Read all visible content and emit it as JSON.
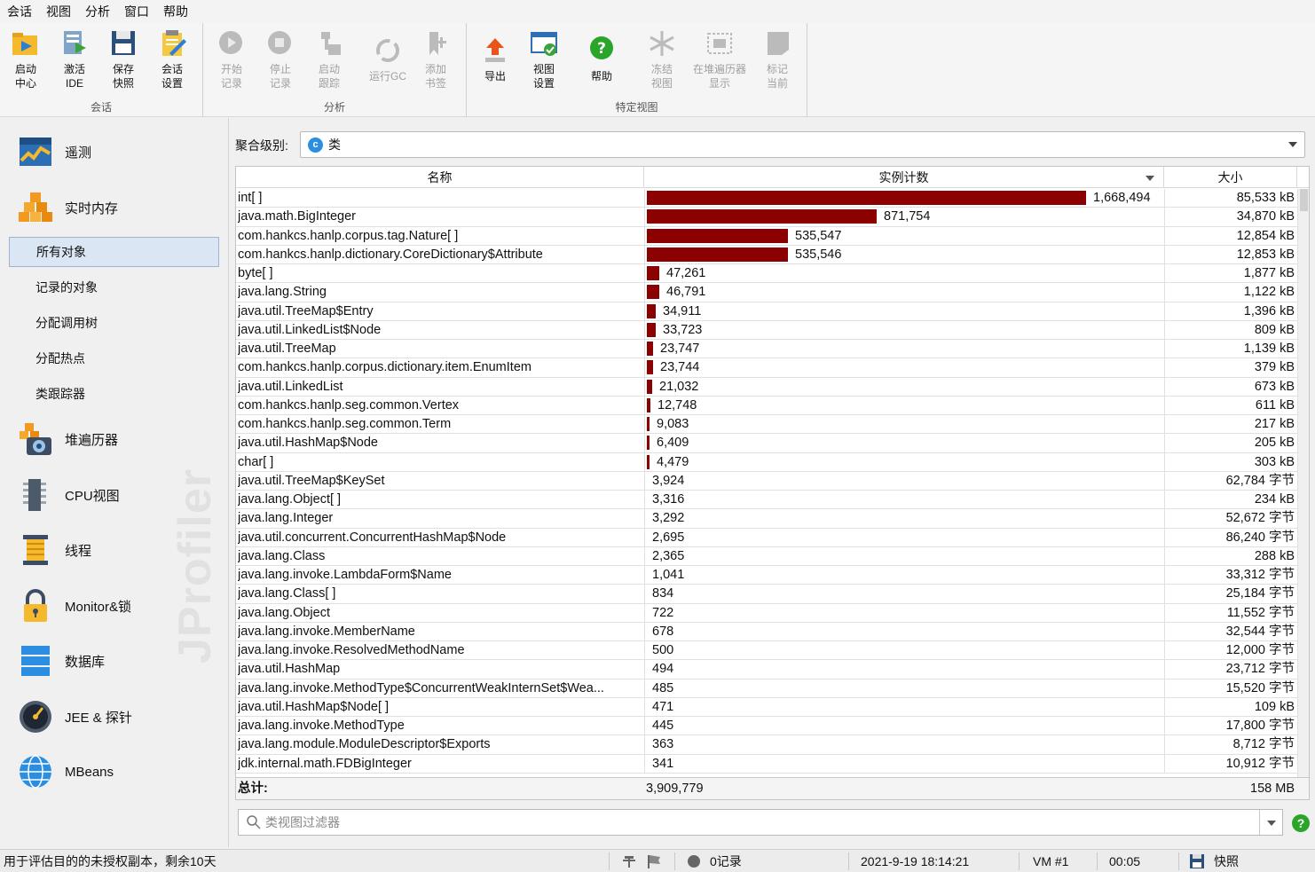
{
  "menu": [
    "会话",
    "视图",
    "分析",
    "窗口",
    "帮助"
  ],
  "toolbar": {
    "groups": [
      "会话",
      "分析",
      "特定视图"
    ],
    "buttons": [
      {
        "line1": "启动",
        "line2": "中心",
        "icon": "launch-center-icon"
      },
      {
        "line1": "激活",
        "line2": "IDE",
        "icon": "activate-ide-icon"
      },
      {
        "line1": "保存",
        "line2": "快照",
        "icon": "save-snapshot-icon"
      },
      {
        "line1": "会话",
        "line2": "设置",
        "icon": "session-settings-icon"
      },
      {
        "line1": "开始",
        "line2": "记录",
        "icon": "start-recording-icon"
      },
      {
        "line1": "停止",
        "line2": "记录",
        "icon": "stop-recording-icon"
      },
      {
        "line1": "启动",
        "line2": "跟踪",
        "icon": "start-tracking-icon"
      },
      {
        "line1": "运行GC",
        "line2": "",
        "icon": "run-gc-icon"
      },
      {
        "line1": "添加",
        "line2": "书签",
        "icon": "add-bookmark-icon"
      },
      {
        "line1": "导出",
        "line2": "",
        "icon": "export-icon"
      },
      {
        "line1": "视图",
        "line2": "设置",
        "icon": "view-settings-icon"
      },
      {
        "line1": "帮助",
        "line2": "",
        "icon": "help-icon"
      },
      {
        "line1": "冻结",
        "line2": "视图",
        "icon": "freeze-view-icon"
      },
      {
        "line1": "在堆遍历器",
        "line2": "显示",
        "icon": "show-in-heap-walker-icon"
      },
      {
        "line1": "标记",
        "line2": "当前",
        "icon": "mark-current-icon"
      }
    ]
  },
  "nav": {
    "telemetry": "遥测",
    "live_memory": "实时内存",
    "sub": [
      "所有对象",
      "记录的对象",
      "分配调用树",
      "分配热点",
      "类跟踪器"
    ],
    "heap_walker": "堆遍历器",
    "cpu": "CPU视图",
    "threads": "线程",
    "monitors": "Monitor&锁",
    "database": "数据库",
    "jee": "JEE & 探针",
    "mbeans": "MBeans",
    "watermark": "JProfiler"
  },
  "aggregation": {
    "label": "聚合级别:",
    "value": "类",
    "icon_letter": "c"
  },
  "table": {
    "headers": {
      "name": "名称",
      "count": "实例计数",
      "size": "大小"
    },
    "max_count": 1668494,
    "rows": [
      {
        "name": "int[ ]",
        "count": "1,668,494",
        "n": 1668494,
        "size": "85,533 kB"
      },
      {
        "name": "java.math.BigInteger",
        "count": "871,754",
        "n": 871754,
        "size": "34,870 kB"
      },
      {
        "name": "com.hankcs.hanlp.corpus.tag.Nature[ ]",
        "count": "535,547",
        "n": 535547,
        "size": "12,854 kB"
      },
      {
        "name": "com.hankcs.hanlp.dictionary.CoreDictionary$Attribute",
        "count": "535,546",
        "n": 535546,
        "size": "12,853 kB"
      },
      {
        "name": "byte[ ]",
        "count": "47,261",
        "n": 47261,
        "size": "1,877 kB"
      },
      {
        "name": "java.lang.String",
        "count": "46,791",
        "n": 46791,
        "size": "1,122 kB"
      },
      {
        "name": "java.util.TreeMap$Entry",
        "count": "34,911",
        "n": 34911,
        "size": "1,396 kB"
      },
      {
        "name": "java.util.LinkedList$Node",
        "count": "33,723",
        "n": 33723,
        "size": "809 kB"
      },
      {
        "name": "java.util.TreeMap",
        "count": "23,747",
        "n": 23747,
        "size": "1,139 kB"
      },
      {
        "name": "com.hankcs.hanlp.corpus.dictionary.item.EnumItem",
        "count": "23,744",
        "n": 23744,
        "size": "379 kB"
      },
      {
        "name": "java.util.LinkedList",
        "count": "21,032",
        "n": 21032,
        "size": "673 kB"
      },
      {
        "name": "com.hankcs.hanlp.seg.common.Vertex",
        "count": "12,748",
        "n": 12748,
        "size": "611 kB"
      },
      {
        "name": "com.hankcs.hanlp.seg.common.Term",
        "count": "9,083",
        "n": 9083,
        "size": "217 kB"
      },
      {
        "name": "java.util.HashMap$Node",
        "count": "6,409",
        "n": 6409,
        "size": "205 kB"
      },
      {
        "name": "char[ ]",
        "count": "4,479",
        "n": 4479,
        "size": "303 kB"
      },
      {
        "name": "java.util.TreeMap$KeySet",
        "count": "3,924",
        "n": 3924,
        "size": "62,784 字节"
      },
      {
        "name": "java.lang.Object[ ]",
        "count": "3,316",
        "n": 3316,
        "size": "234 kB"
      },
      {
        "name": "java.lang.Integer",
        "count": "3,292",
        "n": 3292,
        "size": "52,672 字节"
      },
      {
        "name": "java.util.concurrent.ConcurrentHashMap$Node",
        "count": "2,695",
        "n": 2695,
        "size": "86,240 字节"
      },
      {
        "name": "java.lang.Class",
        "count": "2,365",
        "n": 2365,
        "size": "288 kB"
      },
      {
        "name": "java.lang.invoke.LambdaForm$Name",
        "count": "1,041",
        "n": 1041,
        "size": "33,312 字节"
      },
      {
        "name": "java.lang.Class[ ]",
        "count": "834",
        "n": 834,
        "size": "25,184 字节"
      },
      {
        "name": "java.lang.Object",
        "count": "722",
        "n": 722,
        "size": "11,552 字节"
      },
      {
        "name": "java.lang.invoke.MemberName",
        "count": "678",
        "n": 678,
        "size": "32,544 字节"
      },
      {
        "name": "java.lang.invoke.ResolvedMethodName",
        "count": "500",
        "n": 500,
        "size": "12,000 字节"
      },
      {
        "name": "java.util.HashMap",
        "count": "494",
        "n": 494,
        "size": "23,712 字节"
      },
      {
        "name": "java.lang.invoke.MethodType$ConcurrentWeakInternSet$Wea...",
        "count": "485",
        "n": 485,
        "size": "15,520 字节"
      },
      {
        "name": "java.util.HashMap$Node[ ]",
        "count": "471",
        "n": 471,
        "size": "109 kB"
      },
      {
        "name": "java.lang.invoke.MethodType",
        "count": "445",
        "n": 445,
        "size": "17,800 字节"
      },
      {
        "name": "java.lang.module.ModuleDescriptor$Exports",
        "count": "363",
        "n": 363,
        "size": "8,712 字节"
      },
      {
        "name": "jdk.internal.math.FDBigInteger",
        "count": "341",
        "n": 341,
        "size": "10,912 字节"
      }
    ],
    "total": {
      "label": "总计:",
      "count": "3,909,779",
      "size": "158 MB"
    }
  },
  "filter": {
    "placeholder": "类视图过滤器"
  },
  "status": {
    "license": "用于评估目的的未授权副本，剩余10天",
    "recordings": "0记录",
    "datetime": "2021-9-19 18:14:21",
    "vm": "VM #1",
    "elapsed": "00:05",
    "mode": "快照"
  },
  "colors": {
    "bar": "#8b0000",
    "selection": "#dbe6f4",
    "accent": "#2c8ee0"
  }
}
